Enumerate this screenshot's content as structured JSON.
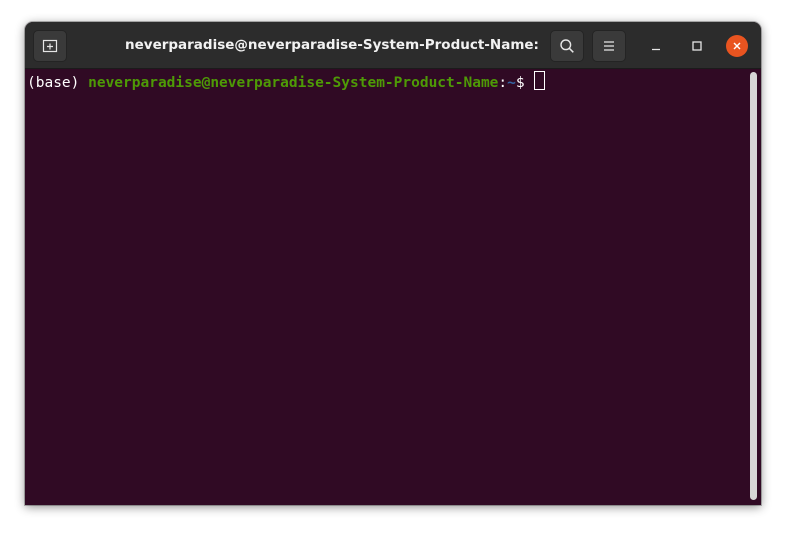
{
  "window": {
    "title": "neverparadise@neverparadise-System-Product-Name: ~"
  },
  "titlebar": {
    "new_tab_icon": "new-tab-icon",
    "search_icon": "search-icon",
    "menu_icon": "hamburger-menu-icon",
    "minimize_icon": "minimize-icon",
    "maximize_icon": "maximize-icon",
    "close_icon": "close-icon"
  },
  "terminal": {
    "env": "(base) ",
    "user_host": "neverparadise@neverparadise-System-Product-Name",
    "colon": ":",
    "path": "~",
    "prompt_symbol": "$ "
  },
  "colors": {
    "background": "#300a24",
    "user_host": "#4e9a06",
    "path": "#3465a4",
    "close_button": "#e95420"
  }
}
